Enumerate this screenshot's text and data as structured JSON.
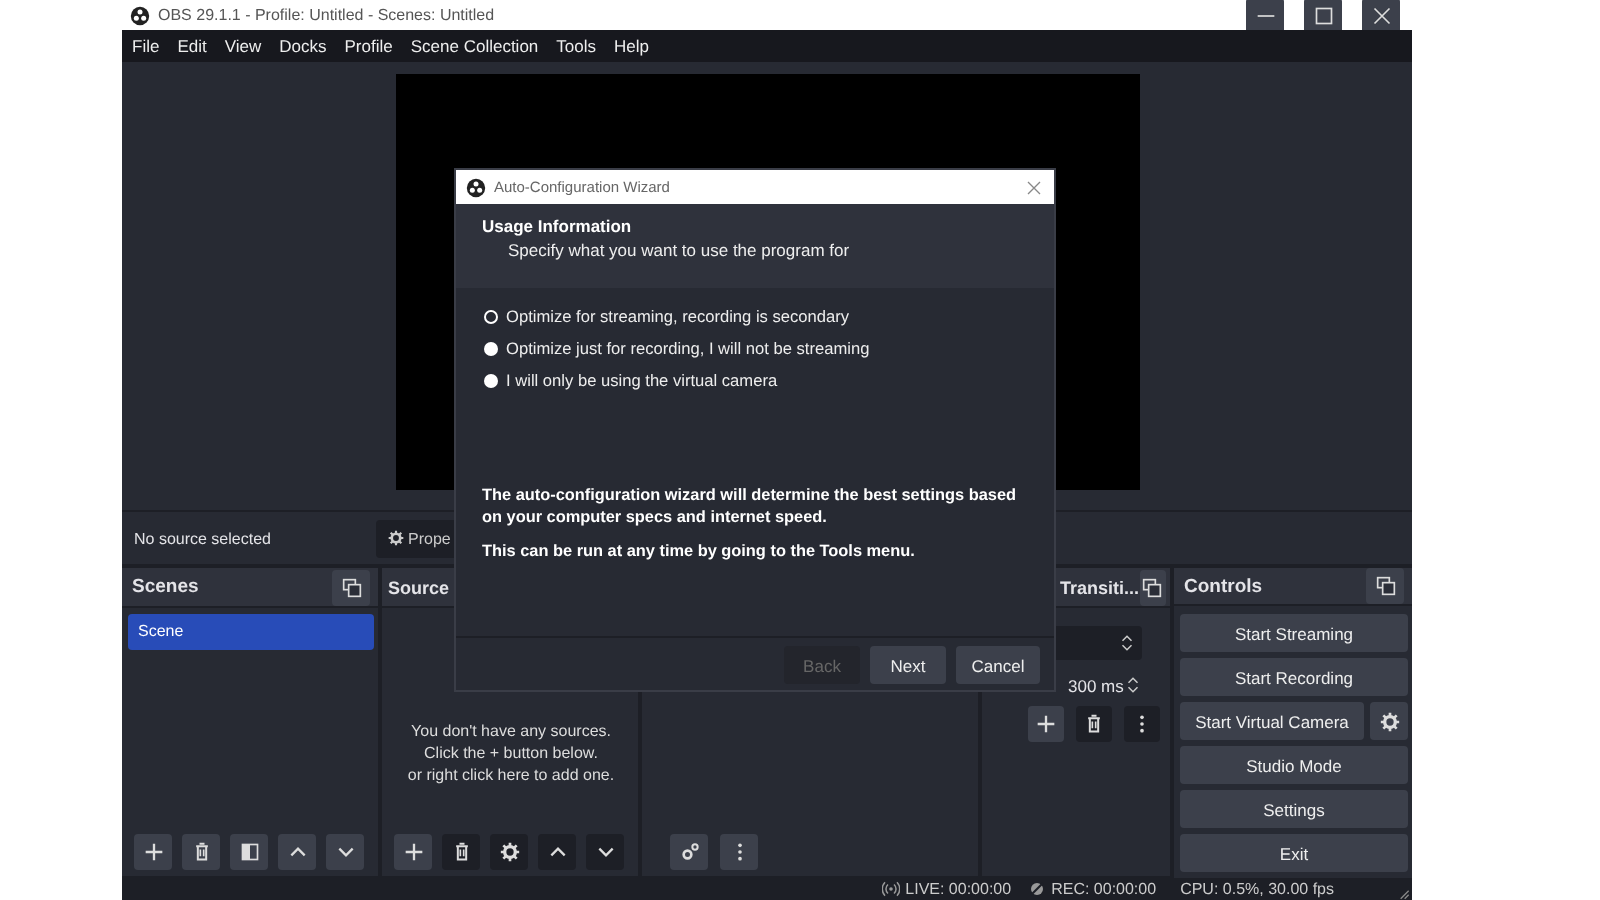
{
  "window": {
    "title": "OBS 29.1.1 - Profile: Untitled - Scenes: Untitled"
  },
  "menu": [
    "File",
    "Edit",
    "View",
    "Docks",
    "Profile",
    "Scene Collection",
    "Tools",
    "Help"
  ],
  "source_bar": {
    "label": "No source selected",
    "properties_button": "Prope"
  },
  "scenes": {
    "title": "Scenes",
    "items": [
      {
        "label": "Scene",
        "selected": true
      }
    ]
  },
  "sources": {
    "title": "Source",
    "empty_message": [
      "You don't have any sources.",
      "Click the + button below.",
      "or right click here to add one."
    ]
  },
  "transitions": {
    "title": "Transiti...",
    "duration": "300 ms"
  },
  "controls": {
    "title": "Controls",
    "buttons": [
      {
        "label": "Start Streaming",
        "kind": "plain"
      },
      {
        "label": "Start Recording",
        "kind": "plain"
      },
      {
        "label": "Start Virtual Camera",
        "kind": "with-settings"
      },
      {
        "label": "Studio Mode",
        "kind": "plain"
      },
      {
        "label": "Settings",
        "kind": "plain"
      },
      {
        "label": "Exit",
        "kind": "plain"
      }
    ]
  },
  "status_bar": {
    "live": "LIVE: 00:00:00",
    "rec": "REC: 00:00:00",
    "cpu": "CPU: 0.5%, 30.00 fps"
  },
  "dialog": {
    "title": "Auto-Configuration Wizard",
    "heading": "Usage Information",
    "subheading": "Specify what you want to use the program for",
    "options": [
      {
        "label": "Optimize for streaming, recording is secondary",
        "selected": true
      },
      {
        "label": "Optimize just for recording, I will not be streaming",
        "selected": false
      },
      {
        "label": "I will only be using the virtual camera",
        "selected": false
      }
    ],
    "notes": [
      "The auto-configuration wizard will determine the best settings based on your computer specs and internet speed.",
      "This can be run at any time by going to the Tools menu."
    ],
    "buttons": [
      {
        "label": "Back",
        "disabled": true
      },
      {
        "label": "Next",
        "disabled": false
      },
      {
        "label": "Cancel",
        "disabled": false
      }
    ]
  }
}
